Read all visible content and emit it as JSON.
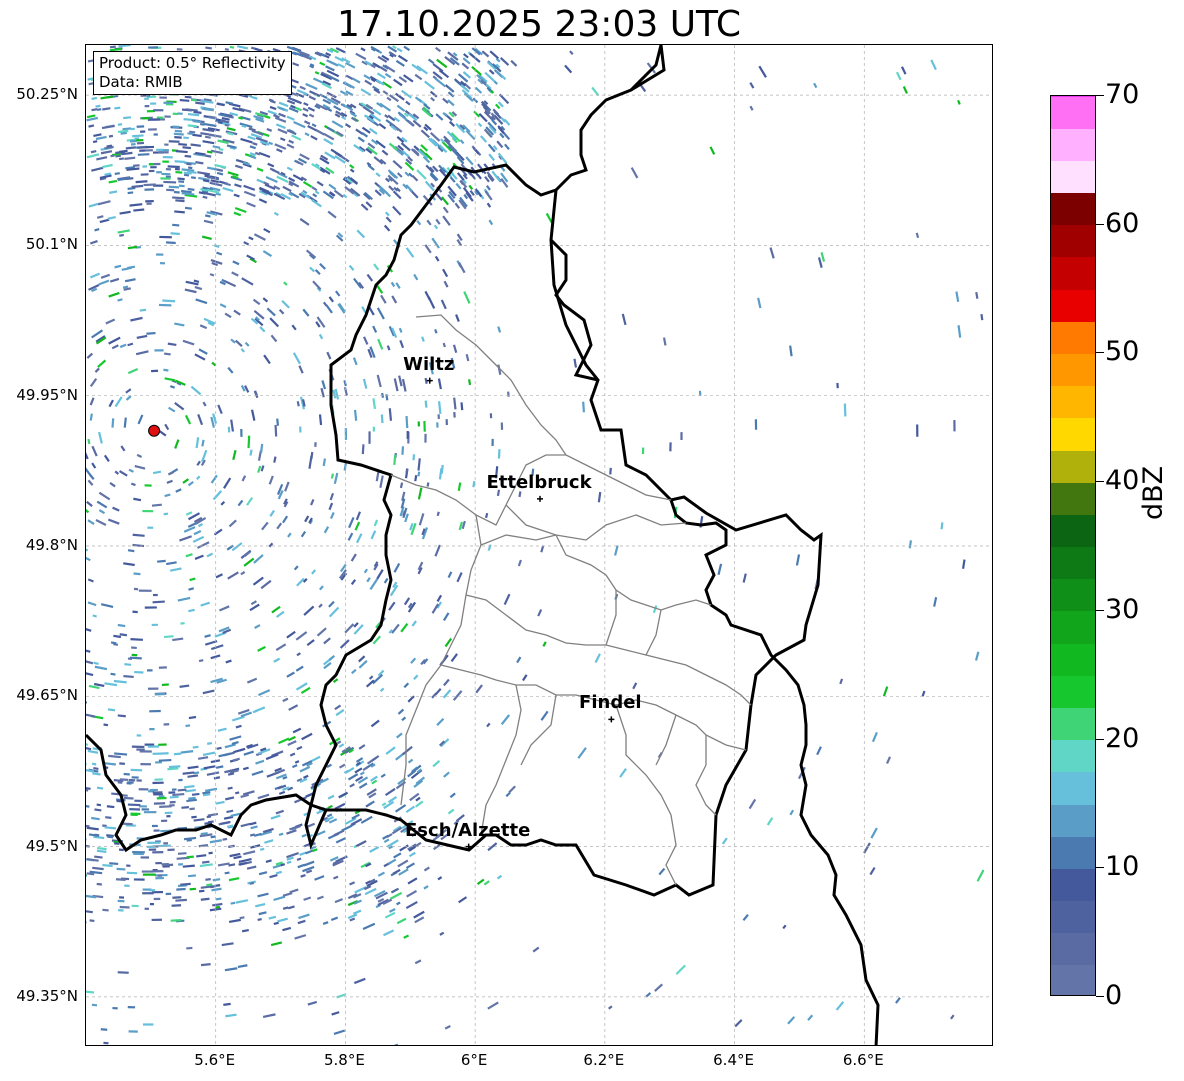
{
  "title": "17.10.2025 23:03 UTC",
  "info_box": {
    "line1": "Product: 0.5° Reflectivity",
    "line2": "Data: RMIB"
  },
  "map_extent": {
    "lon_min": 5.4,
    "lon_max": 6.8,
    "lat_min": 49.3,
    "lat_max": 50.3
  },
  "latitude_ticks": [
    {
      "value": 50.25,
      "label": "50.25°N"
    },
    {
      "value": 50.1,
      "label": "50.1°N"
    },
    {
      "value": 49.95,
      "label": "49.95°N"
    },
    {
      "value": 49.8,
      "label": "49.8°N"
    },
    {
      "value": 49.65,
      "label": "49.65°N"
    },
    {
      "value": 49.5,
      "label": "49.5°N"
    },
    {
      "value": 49.35,
      "label": "49.35°N"
    }
  ],
  "longitude_ticks": [
    {
      "value": 5.6,
      "label": "5.6°E"
    },
    {
      "value": 5.8,
      "label": "5.8°E"
    },
    {
      "value": 6.0,
      "label": "6°E"
    },
    {
      "value": 6.2,
      "label": "6.2°E"
    },
    {
      "value": 6.4,
      "label": "6.4°E"
    },
    {
      "value": 6.6,
      "label": "6.6°E"
    }
  ],
  "cities": [
    {
      "name": "Wiltz",
      "lon": 5.93,
      "lat": 49.965
    },
    {
      "name": "Ettelbruck",
      "lon": 6.1,
      "lat": 49.847
    },
    {
      "name": "Findel",
      "lon": 6.21,
      "lat": 49.627
    },
    {
      "name": "Esch/Alzette",
      "lon": 5.99,
      "lat": 49.5
    }
  ],
  "radar_site": {
    "lon": 5.505,
    "lat": 49.915,
    "color": "#e01010"
  },
  "colorbar": {
    "unit": "dBZ",
    "min": 0,
    "max": 70,
    "labels": [
      "0",
      "10",
      "20",
      "30",
      "40",
      "50",
      "60",
      "70"
    ],
    "colors": [
      "#6375a8",
      "#5a6ba4",
      "#4f62a0",
      "#44599c",
      "#4a7ab0",
      "#5a9ec8",
      "#66c0dc",
      "#5fd6c6",
      "#3fd476",
      "#16c82e",
      "#12b81f",
      "#11a51c",
      "#0f8f18",
      "#0d7a15",
      "#0b6512",
      "#42770f",
      "#b0b10b",
      "#ffd800",
      "#ffb600",
      "#ff9800",
      "#ff7a00",
      "#e80000",
      "#c40000",
      "#a00000",
      "#7c0000",
      "#ffe0ff",
      "#ffb0ff",
      "#ff70f5",
      "#ee38ee"
    ]
  }
}
